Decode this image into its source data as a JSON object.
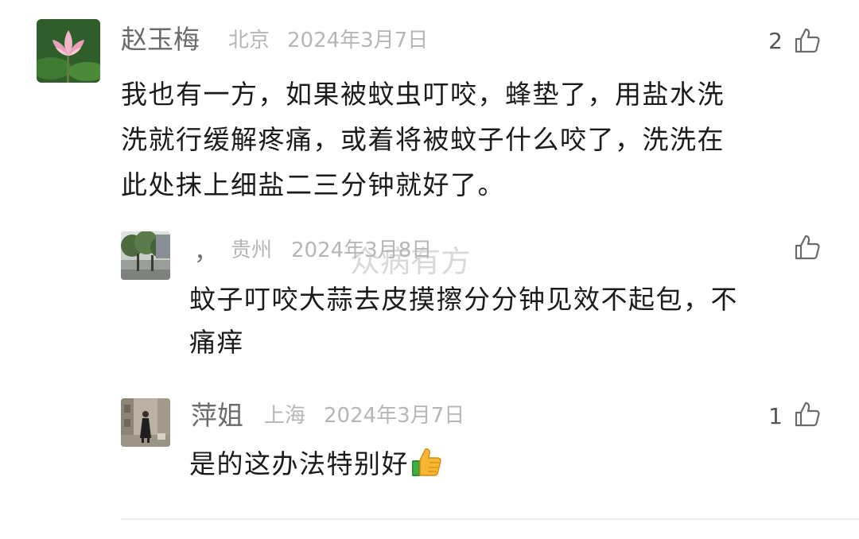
{
  "watermark": "众病有方",
  "comments": [
    {
      "name": "赵玉梅",
      "location": "北京",
      "date": "2024年3月7日",
      "likes": "2",
      "avatar_icon": "lotus-flower-avatar",
      "lines": [
        "我也有一方，如果被蚊虫叮咬，蜂垫了，用盐水洗",
        "洗就行缓解疼痛，或着将被蚊子什么咬了，洗洗在",
        "此处抹上细盐二三分钟就好了。"
      ]
    },
    {
      "name": "，",
      "location": "贵州",
      "date": "2024年3月8日",
      "likes": "",
      "avatar_icon": "trees-street-avatar",
      "lines": [
        "蚊子叮咬大蒜去皮摸擦分分钟见效不起包，不",
        "痛痒"
      ]
    },
    {
      "name": "萍姐",
      "location": "上海",
      "date": "2024年3月7日",
      "likes": "1",
      "avatar_icon": "woman-alley-avatar",
      "lines": [
        "是的这办法特别好"
      ],
      "trailing_emoji": "thumbs-up-emoji"
    }
  ],
  "colors": {
    "name": "#6b6b6b",
    "meta": "#b6b6b6",
    "text": "#1b1b1b",
    "icon": "#6a6a6a"
  }
}
